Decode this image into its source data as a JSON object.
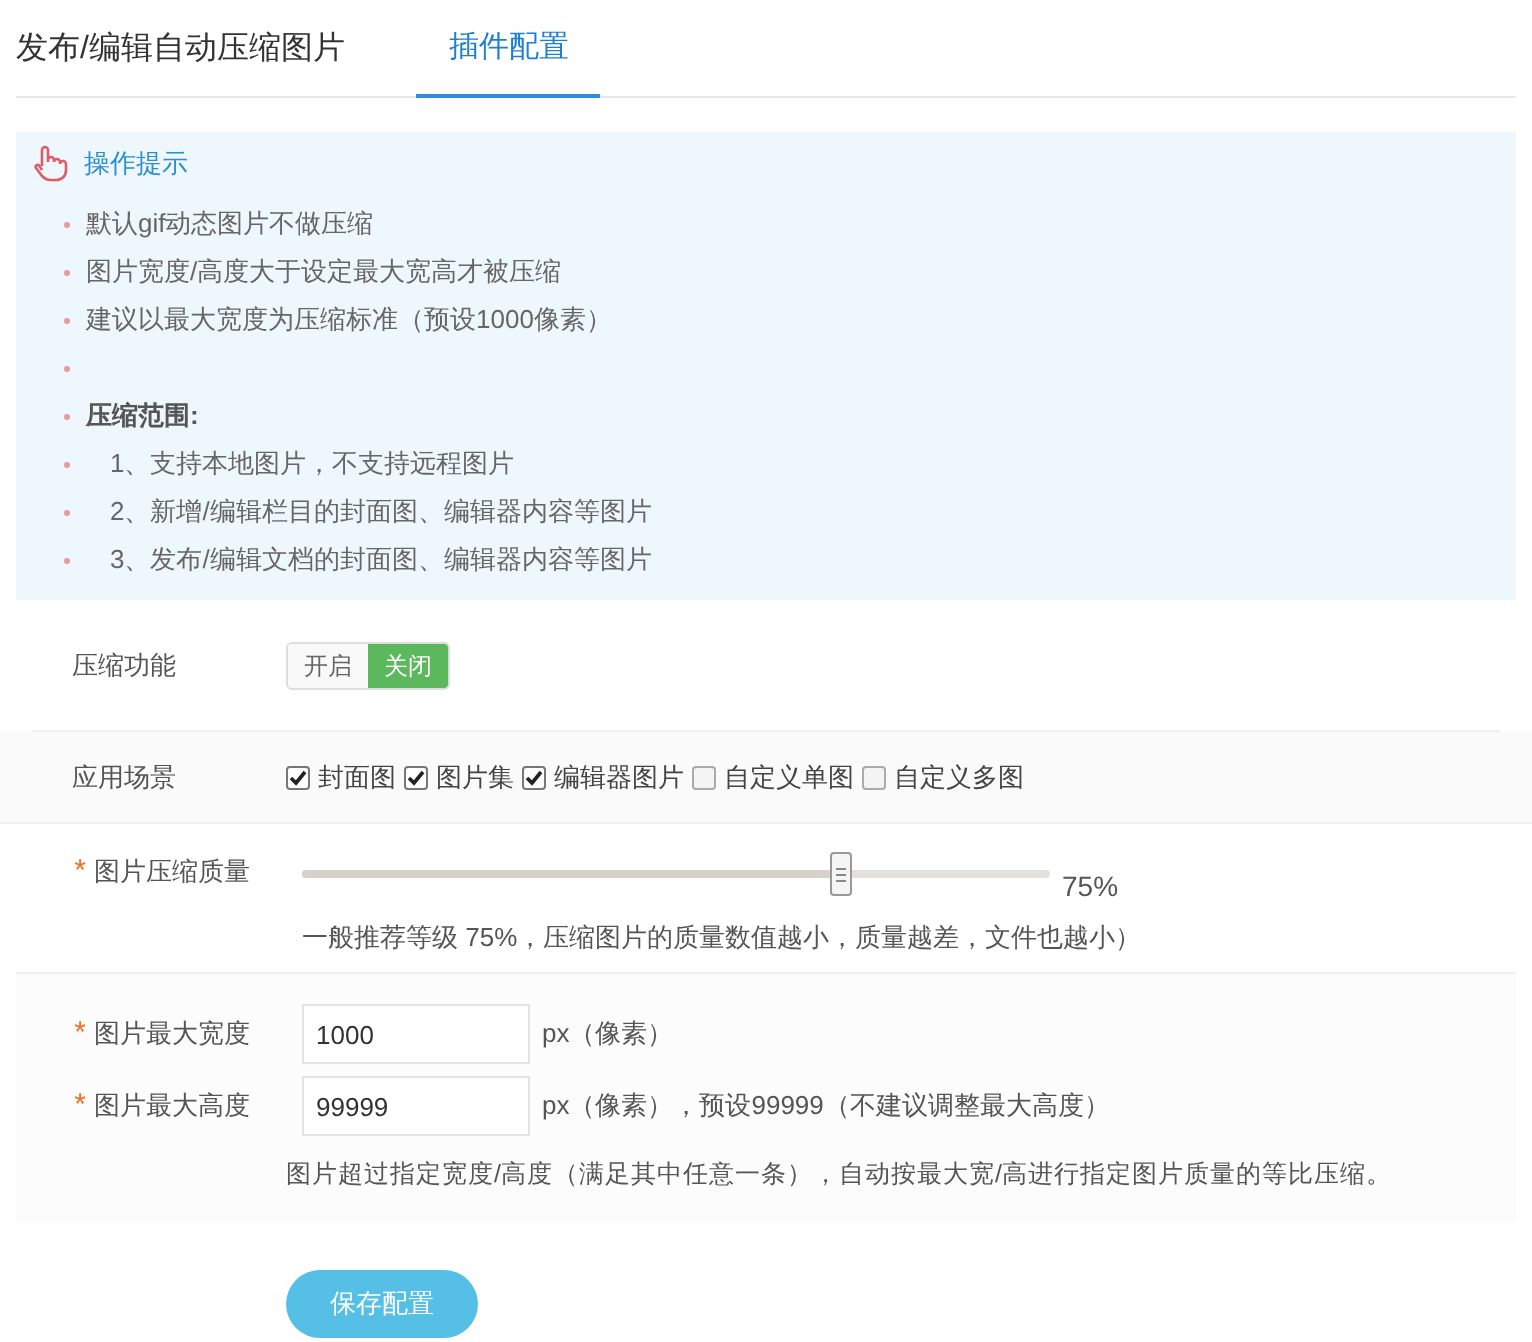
{
  "tabs": [
    {
      "label": "发布/编辑自动压缩图片",
      "selected": false
    },
    {
      "label": "插件配置",
      "selected": true
    }
  ],
  "tips": {
    "title": "操作提示",
    "items": [
      {
        "kind": "text",
        "text": "默认gif动态图片不做压缩"
      },
      {
        "kind": "text",
        "text": "图片宽度/高度大于设定最大宽高才被压缩"
      },
      {
        "kind": "text",
        "text": "建议以最大宽度为压缩标准（预设1000像素）"
      },
      {
        "kind": "blank"
      },
      {
        "kind": "heading",
        "text": "压缩范围:"
      },
      {
        "kind": "sub",
        "text": "1、支持本地图片，不支持远程图片"
      },
      {
        "kind": "sub",
        "text": "2、新增/编辑栏目的封面图、编辑器内容等图片"
      },
      {
        "kind": "sub",
        "text": "3、发布/编辑文档的封面图、编辑器内容等图片"
      }
    ]
  },
  "compress": {
    "label": "压缩功能",
    "options": [
      {
        "label": "开启",
        "selected": false
      },
      {
        "label": "关闭",
        "selected": true
      }
    ]
  },
  "scenes": {
    "label": "应用场景",
    "options": [
      {
        "label": "封面图",
        "checked": true
      },
      {
        "label": "图片集",
        "checked": true
      },
      {
        "label": "编辑器图片",
        "checked": true
      },
      {
        "label": "自定义单图",
        "checked": false
      },
      {
        "label": "自定义多图",
        "checked": false
      }
    ]
  },
  "quality": {
    "label": "图片压缩质量",
    "required_mark": "*",
    "level": 0.72,
    "reading": "75%",
    "hint": "一般推荐等级 75%，压缩图片的质量数值越小，质量越差，文件也越小）"
  },
  "max_width": {
    "label": "图片最大宽度",
    "required_mark": "*",
    "value": "1000",
    "unit": "px（像素）"
  },
  "max_height": {
    "label": "图片最大高度",
    "required_mark": "*",
    "value": "99999",
    "unit": "px（像素），预设99999（不建议调整最大高度）"
  },
  "size_hint": "图片超过指定宽度/高度（满足其中任意一条），自动按最大宽/高进行指定图片质量的等比压缩。",
  "save_button": "保存配置"
}
